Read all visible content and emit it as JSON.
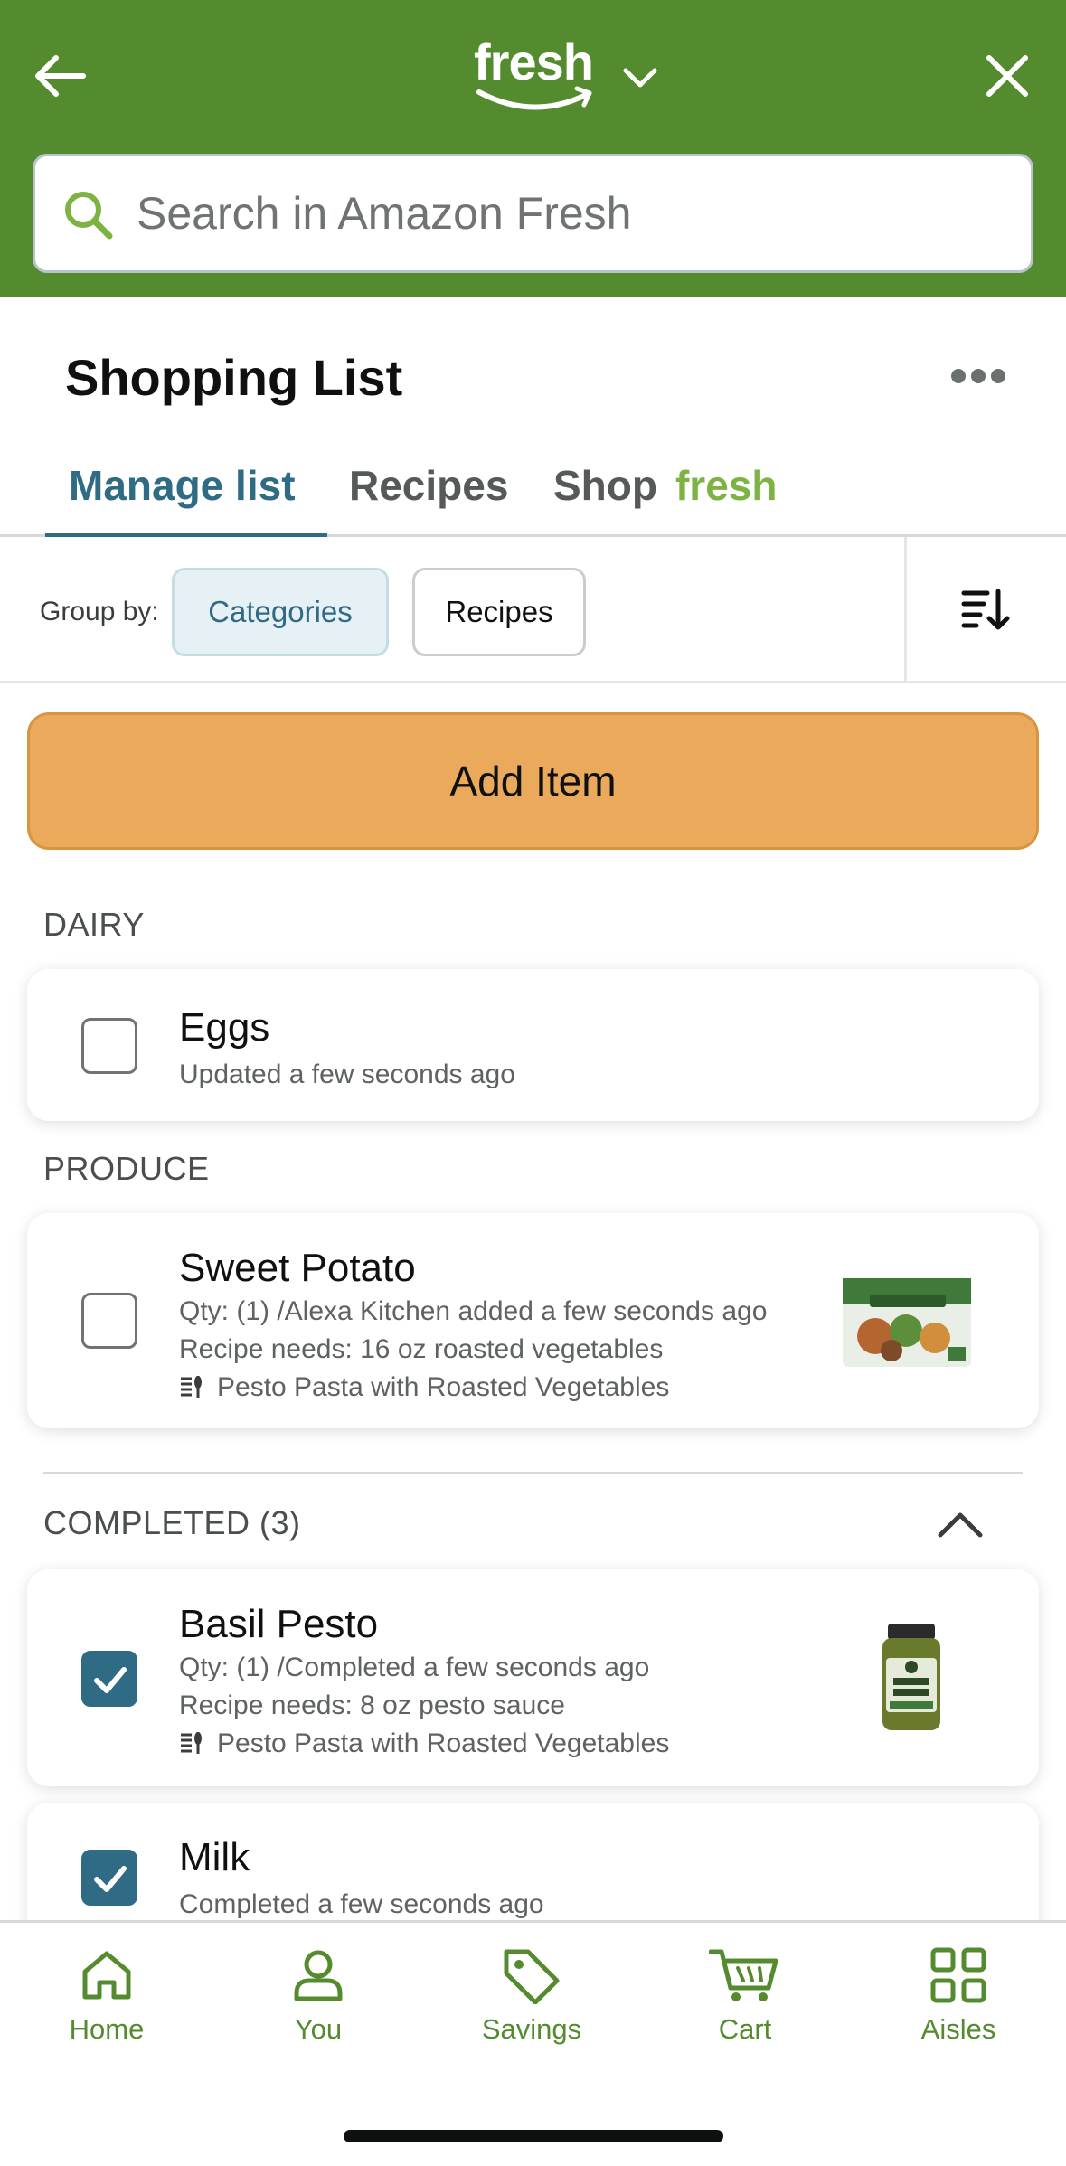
{
  "header": {
    "brand": "fresh",
    "search_placeholder": "Search in Amazon Fresh"
  },
  "page": {
    "title": "Shopping List"
  },
  "tabs": [
    {
      "label": "Manage list",
      "active": true
    },
    {
      "label": "Recipes",
      "active": false
    },
    {
      "label": "Shop",
      "suffix": "fresh",
      "active": false
    }
  ],
  "group_by": {
    "label": "Group by:",
    "options": [
      {
        "label": "Categories",
        "selected": true
      },
      {
        "label": "Recipes",
        "selected": false
      }
    ]
  },
  "add_item_label": "Add Item",
  "sections": {
    "dairy": {
      "label": "DAIRY",
      "items": [
        {
          "name": "Eggs",
          "subtitle": "Updated a few seconds ago",
          "checked": false
        }
      ]
    },
    "produce": {
      "label": "PRODUCE",
      "items": [
        {
          "name": "Sweet Potato",
          "subtitle": "Qty: (1) /Alexa Kitchen added a few seconds ago",
          "recipe_needs": "Recipe needs: 16 oz roasted vegetables",
          "recipe": "Pesto Pasta with Roasted Vegetables",
          "checked": false
        }
      ]
    },
    "completed": {
      "label": "COMPLETED (3)",
      "items": [
        {
          "name": "Basil Pesto",
          "subtitle": "Qty: (1) /Completed a few seconds ago",
          "recipe_needs": "Recipe needs: 8 oz pesto sauce",
          "recipe": "Pesto Pasta with Roasted Vegetables",
          "checked": true
        },
        {
          "name": "Milk",
          "subtitle": "Completed a few seconds ago",
          "checked": true
        }
      ]
    }
  },
  "bottom_nav": [
    {
      "label": "Home",
      "icon": "home-icon"
    },
    {
      "label": "You",
      "icon": "person-icon"
    },
    {
      "label": "Savings",
      "icon": "tag-icon"
    },
    {
      "label": "Cart",
      "icon": "cart-icon"
    },
    {
      "label": "Aisles",
      "icon": "grid-icon"
    }
  ],
  "colors": {
    "header_bg": "#558b2f",
    "accent_teal": "#2f6b84",
    "add_button": "#eba95c",
    "fresh_green": "#7cb342"
  }
}
